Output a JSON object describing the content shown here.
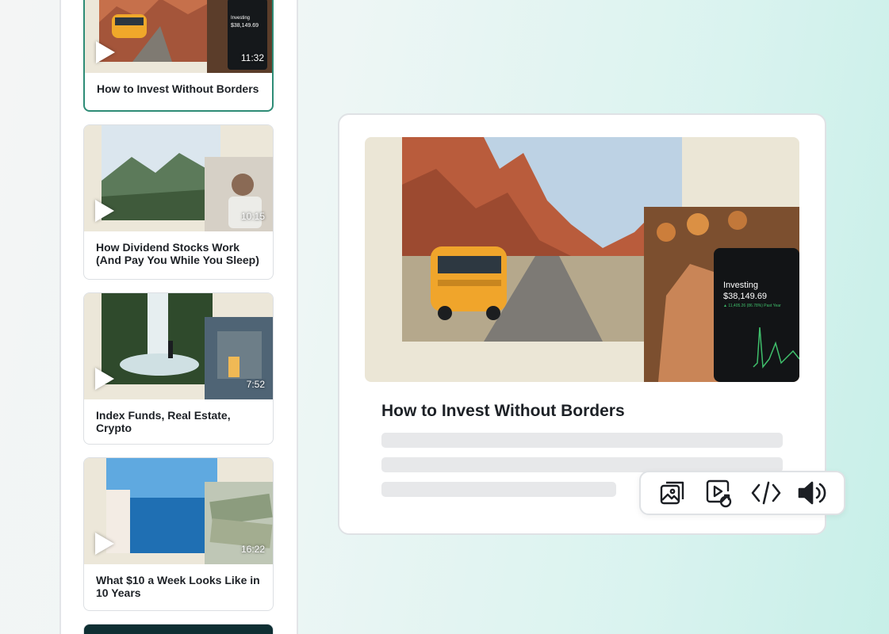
{
  "videos": [
    {
      "title": "How to Invest Without Borders",
      "duration": "11:32",
      "active": true
    },
    {
      "title": "How Dividend Stocks Work (And Pay You While You Sleep)",
      "duration": "10:15",
      "active": false
    },
    {
      "title": "Index Funds, Real Estate, Crypto",
      "duration": "7:52",
      "active": false
    },
    {
      "title": "What $10 a Week Looks Like in 10 Years",
      "duration": "16:22",
      "active": false
    }
  ],
  "detail": {
    "title": "How to Invest Without Borders",
    "phone": {
      "app_label": "Investing",
      "balance": "$38,149.69",
      "change": "▲ 11,405.26 (86.78%) Past Year"
    }
  },
  "toolbar": {
    "tools": [
      {
        "icon": "image-gallery-icon"
      },
      {
        "icon": "video-link-icon"
      },
      {
        "icon": "code-icon"
      },
      {
        "icon": "speaker-icon"
      }
    ]
  },
  "colors": {
    "accent": "#2e8c76",
    "background_mint": "#c7efe8"
  }
}
